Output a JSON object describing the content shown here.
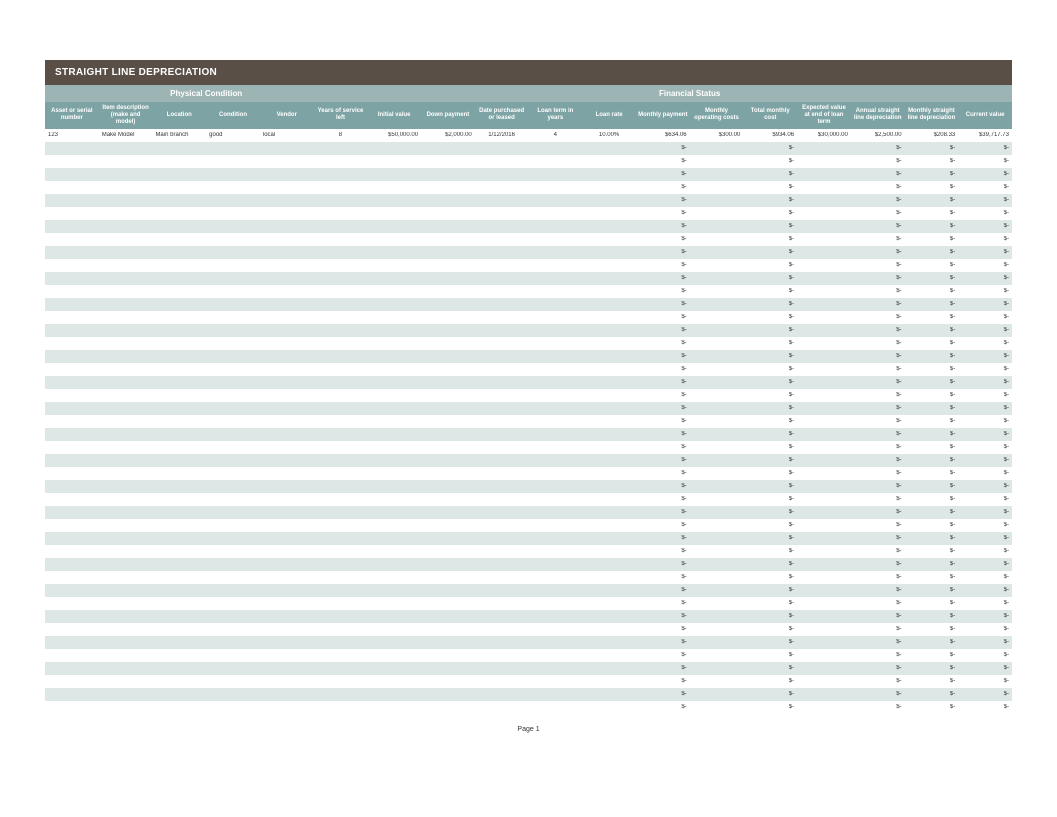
{
  "title": "STRAIGHT LINE DEPRECIATION",
  "section_headers": {
    "physical": "Physical Condition",
    "financial": "Financial Status"
  },
  "columns": [
    "Asset or serial number",
    "Item description (make and model)",
    "Location",
    "Condition",
    "Vendor",
    "Years of service left",
    "Initial value",
    "Down payment",
    "Date purchased or leased",
    "Loan term in years",
    "Loan rate",
    "Monthly payment",
    "Monthly operating costs",
    "Total monthly cost",
    "Expected value at end of loan term",
    "Annual straight line depreciation",
    "Monthly straight line depreciation",
    "Current value"
  ],
  "first_row": {
    "serial": "123",
    "desc": "Make Model",
    "location": "Main branch",
    "condition": "good",
    "vendor": "local",
    "years_left": "8",
    "initial_value": "$50,000.00",
    "down_payment": "$2,000.00",
    "date": "1/12/2016",
    "loan_term": "4",
    "loan_rate": "10.00%",
    "monthly_payment": "$634.06",
    "monthly_op_costs": "$300.00",
    "total_monthly_cost": "$934.06",
    "expected_end_value": "$30,000.00",
    "annual_sl": "$2,500.00",
    "monthly_sl": "$208.33",
    "current_value": "$39,717.73"
  },
  "empty_placeholder": "$-",
  "empty_row_count": 44,
  "footer": "Page 1"
}
